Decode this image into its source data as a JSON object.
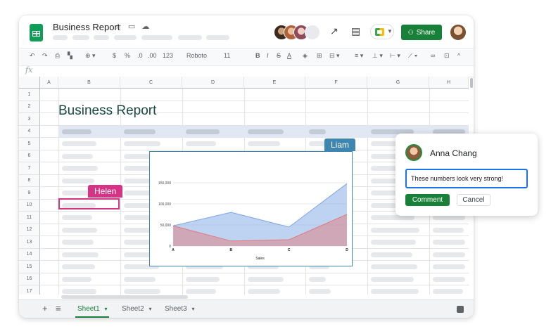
{
  "document": {
    "title": "Business Report",
    "title_icons": "☆ ▭ ☁"
  },
  "colors": {
    "brand_green": "#188038",
    "helen": "#d63384",
    "liam": "#3d86b1",
    "focus_blue": "#1a73e8"
  },
  "header": {
    "collaborator_avatars": [
      "avatar-1",
      "avatar-2",
      "avatar-3",
      "avatar-4"
    ],
    "share_label": "Share",
    "icons": [
      "trending-icon",
      "comment-icon",
      "meet-icon"
    ]
  },
  "toolbar": {
    "font_name": "Roboto",
    "font_size": "11",
    "currency": "$",
    "percent": "%",
    "decimal_less": ".0",
    "decimal_more": ".00",
    "format_more": "123"
  },
  "formula_bar": {
    "fx": "fx"
  },
  "grid": {
    "columns": [
      "A",
      "B",
      "C",
      "D",
      "E",
      "F",
      "G",
      "H"
    ],
    "rows": [
      "1",
      "2",
      "3",
      "4",
      "5",
      "6",
      "7",
      "8",
      "9",
      "10",
      "11",
      "12",
      "13",
      "14",
      "15",
      "16",
      "17"
    ],
    "report_title": "Business Report"
  },
  "collaborators": {
    "helen_label": "Helen",
    "liam_label": "Liam"
  },
  "chart_data": {
    "type": "area",
    "categories": [
      "A",
      "B",
      "C",
      "D"
    ],
    "series": [
      {
        "values": [
          48000,
          80000,
          45000,
          148000
        ],
        "color": "#7ea6e6"
      },
      {
        "values": [
          48000,
          12000,
          15000,
          75000
        ],
        "color": "#e07b7b"
      }
    ],
    "xlabel": "Sales",
    "ylabel": "",
    "ylim": [
      0,
      160000
    ],
    "ticks": [
      "0",
      "50,000",
      "100,000",
      "150,000"
    ],
    "grid": true
  },
  "comment": {
    "author": "Anna Chang",
    "text": "These numbers look very strong!",
    "submit_label": "Comment",
    "cancel_label": "Cancel"
  },
  "bottom": {
    "sheets": [
      "Sheet1",
      "Sheet2",
      "Sheet3"
    ],
    "add_icon": "+",
    "list_icon": "≡",
    "caret": "▾"
  }
}
